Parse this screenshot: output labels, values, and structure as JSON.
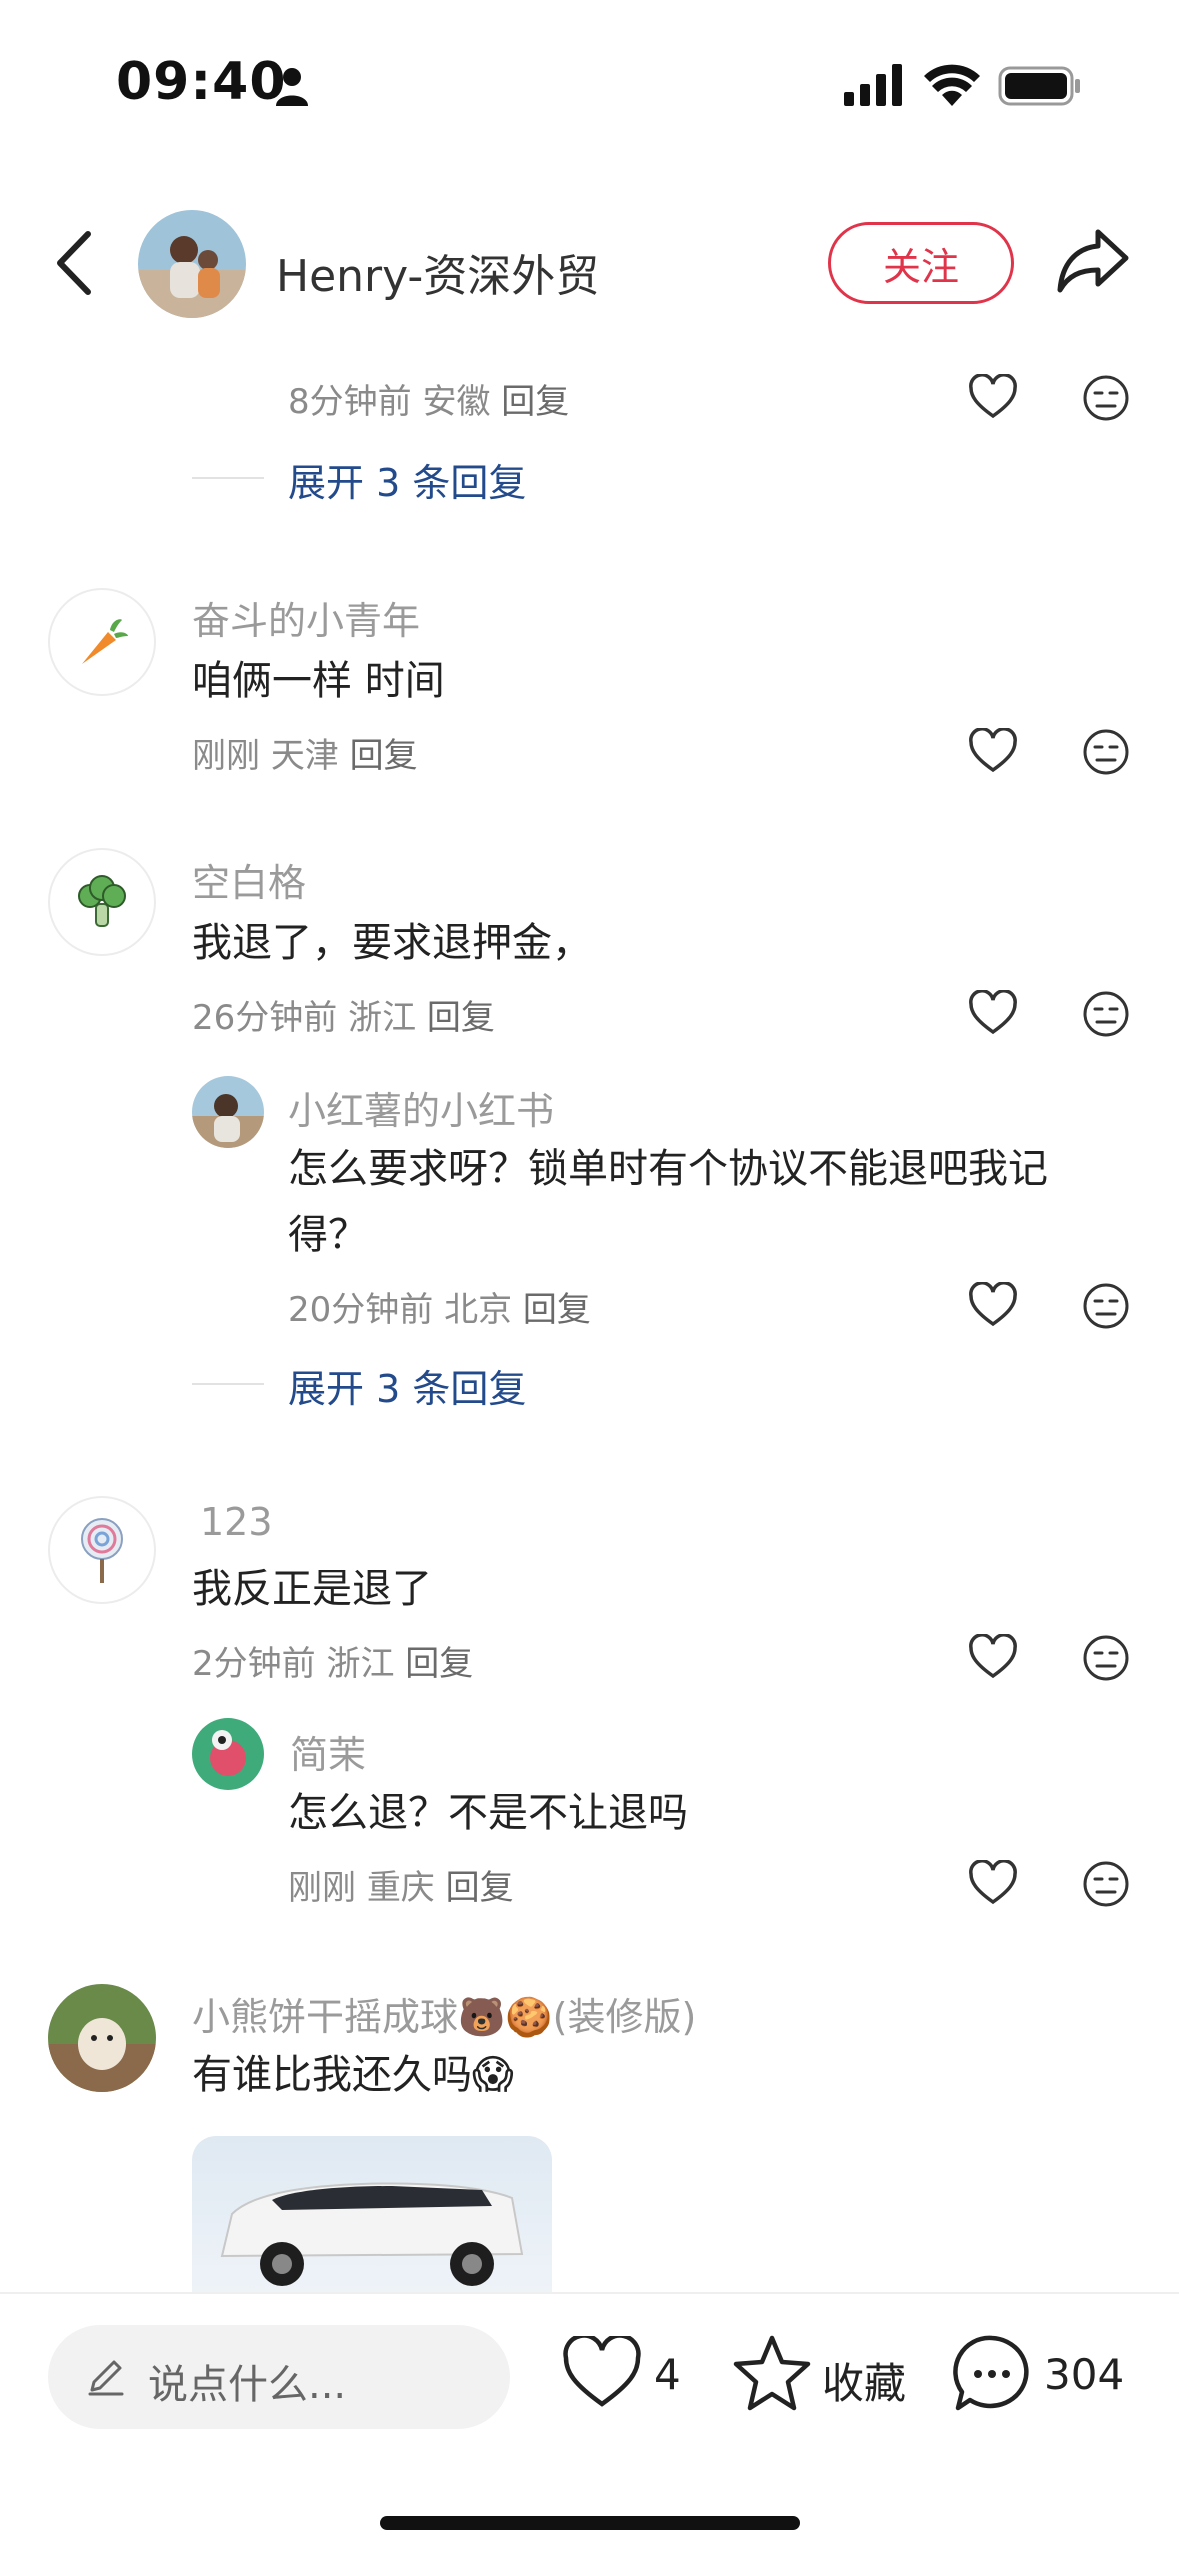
{
  "status_bar": {
    "time": "09:40"
  },
  "header": {
    "name": "Henry-资深外贸",
    "follow_label": "关注"
  },
  "thread": [
    {
      "kind": "meta",
      "time": "8分钟前",
      "location": "安徽",
      "reply": "回复"
    },
    {
      "kind": "expand",
      "label": "展开 3 条回复"
    }
  ],
  "comments": [
    {
      "user": "奋斗的小青年",
      "text": "咱俩一样 时间",
      "time": "刚刚",
      "location": "天津",
      "reply": "回复",
      "avatar": "carrot-icon"
    },
    {
      "user": "空白格",
      "text": "我退了，要求退押金，",
      "time": "26分钟前",
      "location": "浙江",
      "reply": "回复",
      "avatar": "broccoli-icon",
      "sub": {
        "user": "小红薯的小红书",
        "text_line1": "怎么要求呀？锁单时有个协议不能退吧我记",
        "text_line2": "得？",
        "time": "20分钟前",
        "location": "北京",
        "reply": "回复"
      },
      "expand_label": "展开 3 条回复"
    },
    {
      "user": "123",
      "text": "我反正是退了",
      "time": "2分钟前",
      "location": "浙江",
      "reply": "回复",
      "avatar": "lollipop-icon",
      "sub": {
        "user": "简茉",
        "text": "怎么退？不是不让退吗",
        "time": "刚刚",
        "location": "重庆",
        "reply": "回复"
      }
    },
    {
      "user": "小熊饼干摇成球🐻🍪(装修版)",
      "text": "有谁比我还久吗😱"
    }
  ],
  "bottom_bar": {
    "placeholder": "说点什么...",
    "like_count": "4",
    "collect_label": "收藏",
    "comment_count": "304"
  },
  "colors": {
    "accent": "#e0344a",
    "link": "#234b8c",
    "meta": "#8a8a8a"
  }
}
